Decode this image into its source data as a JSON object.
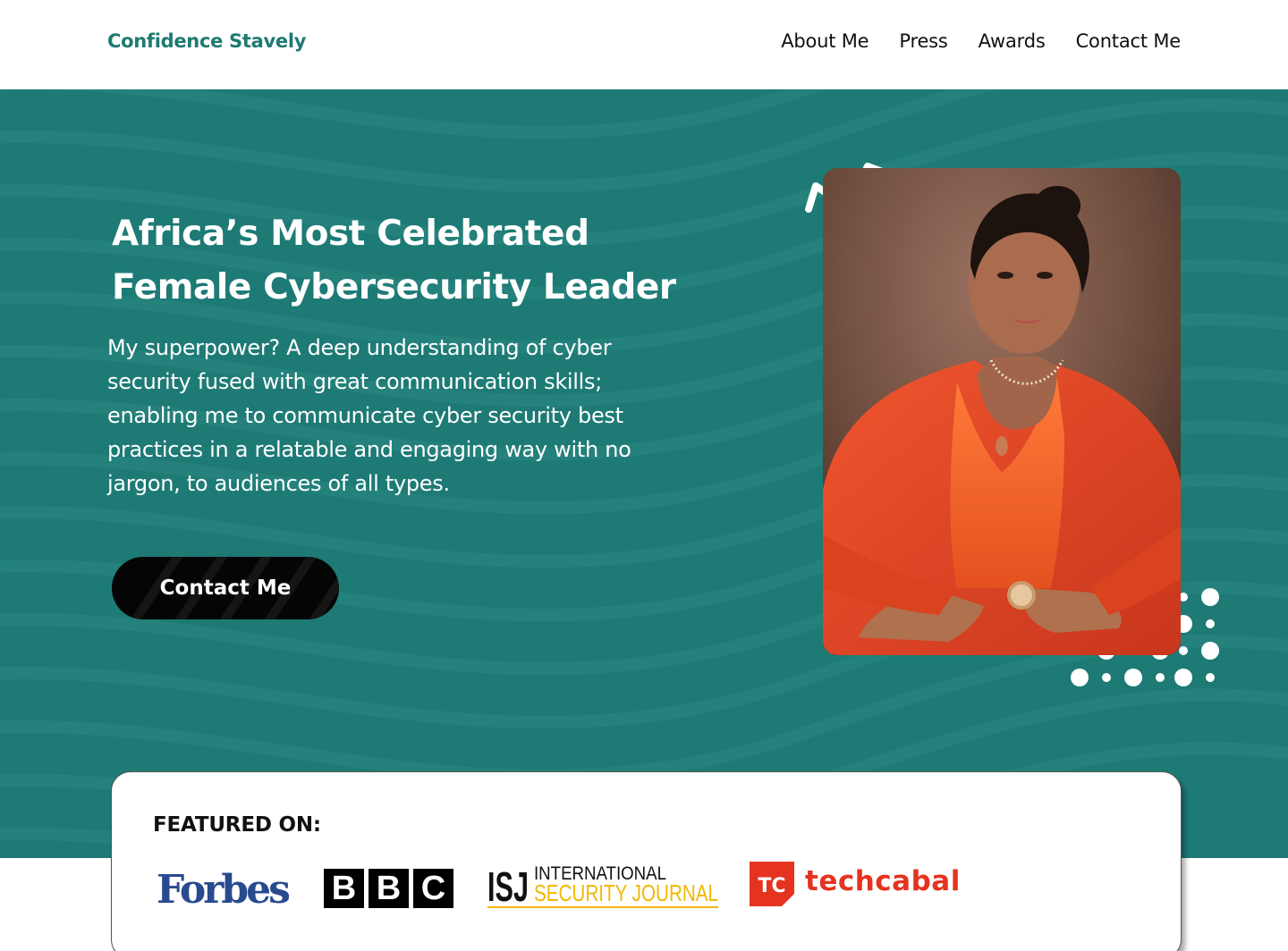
{
  "header": {
    "brand": "Confidence Stavely",
    "nav": [
      "About Me",
      "Press",
      "Awards",
      "Contact Me"
    ]
  },
  "hero": {
    "headline_line1": "Africa’s Most Celebrated",
    "headline_line2": "Female Cybersecurity Leader",
    "lede": "My superpower? A deep understanding of cyber security fused with great communication skills; enabling me to communicate cyber security best practices in a relatable and engaging way with no jargon, to audiences of all types.",
    "cta_label": "Contact Me"
  },
  "featured": {
    "title": "FEATURED ON:",
    "logos": {
      "forbes": "Forbes",
      "bbc": [
        "B",
        "B",
        "C"
      ],
      "isj_short": "ISJ",
      "isj_line1": "INTERNATIONAL",
      "isj_line2": "SECURITY JOURNAL",
      "techcabal_mark": "TC",
      "techcabal": "techcabal"
    }
  },
  "colors": {
    "brand_teal": "#1f7a72",
    "hero_bg": "#1e7a75",
    "cta_bg": "#050505",
    "forbes_blue": "#284a8f",
    "isj_yellow": "#f2b705",
    "techcabal_red": "#e5331f"
  },
  "icons": {
    "zigzag": "zigzag-decoration-icon",
    "dots": "dot-grid-decoration-icon"
  }
}
